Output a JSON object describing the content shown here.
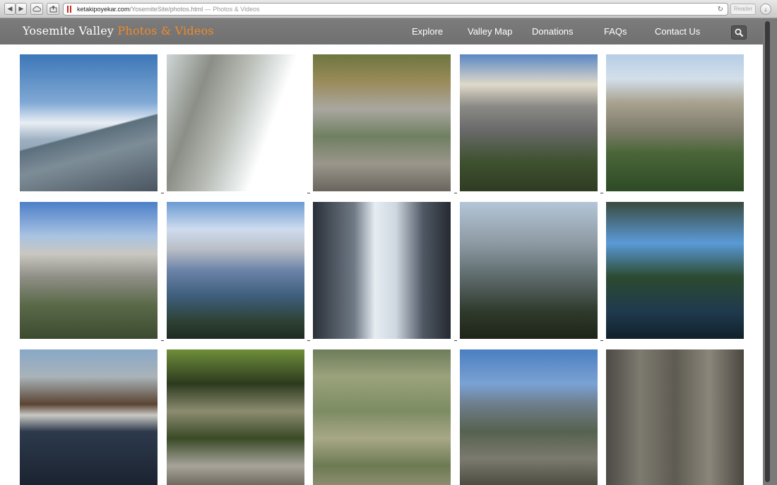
{
  "browser": {
    "url_host": "ketakipoyekar.com",
    "url_path": "/YosemiteSite/photos.html",
    "page_title_suffix": " — Photos & Videos",
    "reader_label": "Reader",
    "back_glyph": "◀",
    "forward_glyph": "▶",
    "reload_glyph": "↻",
    "download_glyph": "↓"
  },
  "site": {
    "title_main": "Yosemite Valley",
    "title_accent": "Photos & Videos",
    "accent_color": "#f08a2a"
  },
  "nav": {
    "items": [
      {
        "label": "Explore"
      },
      {
        "label": "Valley Map"
      },
      {
        "label": "Donations"
      },
      {
        "label": "FAQs"
      },
      {
        "label": "Contact Us"
      }
    ],
    "search_icon": "search-icon"
  },
  "gallery": {
    "photos": [
      {
        "subject": "Half Dome from Glacier Point with pine branches"
      },
      {
        "subject": "El Capitan reflected in Merced River"
      },
      {
        "subject": "Rocky creek bed with grasses"
      },
      {
        "subject": "Bridalveil Fall and cliffs under clouds"
      },
      {
        "subject": "Tunnel View of the valley"
      },
      {
        "subject": "Half Dome with forested slopes"
      },
      {
        "subject": "Snowy peaks and valley forest"
      },
      {
        "subject": "Waterfall cascade close-up"
      },
      {
        "subject": "Granite cliff and tall pine"
      },
      {
        "subject": "River reflection with forest"
      },
      {
        "subject": "Winter river with snow on banks"
      },
      {
        "subject": "Stone bridge through trees"
      },
      {
        "subject": "Clear water over river stones"
      },
      {
        "subject": "Yosemite Falls from overlook"
      },
      {
        "subject": "Granite cliff face with waterfall"
      }
    ]
  }
}
